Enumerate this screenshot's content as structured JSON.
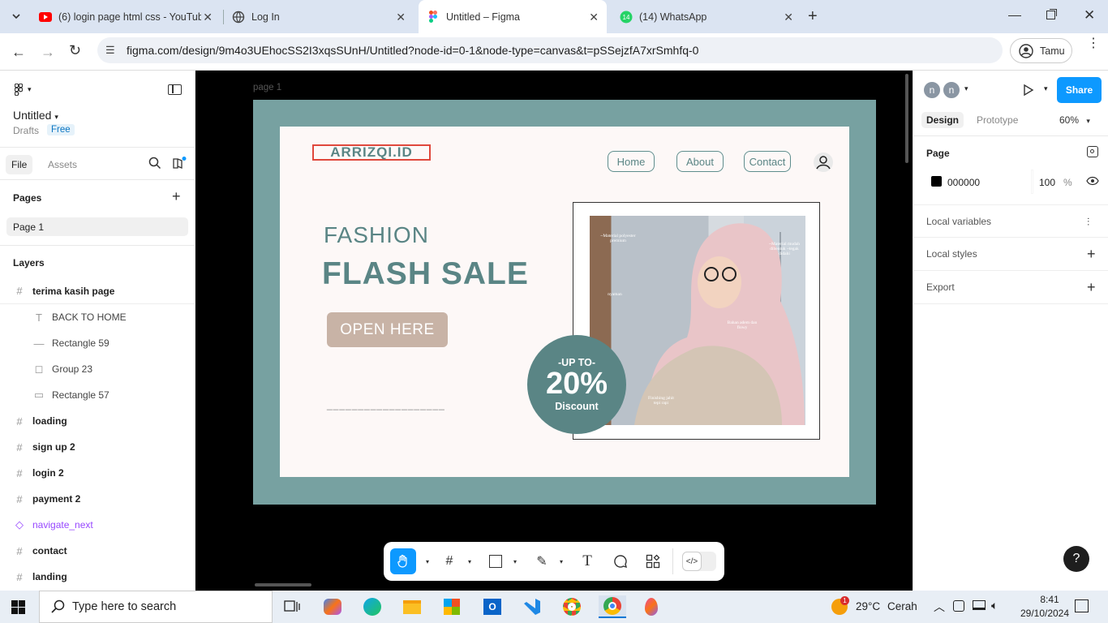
{
  "browser": {
    "tabs": [
      {
        "label": "(6) login page html css - YouTube",
        "icon": "youtube-icon"
      },
      {
        "label": "Log In",
        "icon": "globe-icon"
      },
      {
        "label": "Untitled – Figma",
        "icon": "figma-icon"
      },
      {
        "label": "(14) WhatsApp",
        "icon": "whatsapp-icon",
        "badge": "14"
      }
    ],
    "url": "figma.com/design/9m4o3UEhocSS2I3xqsSUnH/Untitled?node-id=0-1&node-type=canvas&t=pSSejzfA7xrSmhfq-0",
    "profile": "Tamu"
  },
  "figma": {
    "file_name": "Untitled",
    "drafts": "Drafts",
    "plan": "Free",
    "tabs": {
      "file": "File",
      "assets": "Assets"
    },
    "pages_heading": "Pages",
    "pages": [
      "Page 1"
    ],
    "layers_heading": "Layers",
    "layers": [
      {
        "name": "terima kasih page",
        "icon": "frame-icon",
        "level": 0
      },
      {
        "name": "BACK TO HOME",
        "icon": "text-icon",
        "level": 1
      },
      {
        "name": "Rectangle 59",
        "icon": "line-icon",
        "level": 1
      },
      {
        "name": "Group 23",
        "icon": "group-icon",
        "level": 1
      },
      {
        "name": "Rectangle 57",
        "icon": "rectangle-icon",
        "level": 1
      },
      {
        "name": "loading",
        "icon": "frame-icon",
        "level": 0
      },
      {
        "name": "sign up 2",
        "icon": "frame-icon",
        "level": 0
      },
      {
        "name": "login 2",
        "icon": "frame-icon",
        "level": 0
      },
      {
        "name": "payment 2",
        "icon": "frame-icon",
        "level": 0
      },
      {
        "name": "navigate_next",
        "icon": "component-icon",
        "level": 0
      },
      {
        "name": "contact",
        "icon": "frame-icon",
        "level": 0
      },
      {
        "name": "landing",
        "icon": "frame-icon",
        "level": 0
      }
    ],
    "right": {
      "avatars": [
        "n",
        "n"
      ],
      "share": "Share",
      "tab_design": "Design",
      "tab_prototype": "Prototype",
      "zoom": "60%",
      "page_label": "Page",
      "page_color": "000000",
      "page_opacity": "100",
      "percent": "%",
      "local_variables": "Local variables",
      "local_styles": "Local styles",
      "export": "Export"
    },
    "canvas": {
      "frame_label": "page 1",
      "logo": "ARRIZQI.ID",
      "nav": [
        "Home",
        "About",
        "Contact"
      ],
      "headline_small": "FASHION",
      "headline_big": "FLASH SALE",
      "cta": "OPEN HERE",
      "dashes": "___________________",
      "badge_top": "-UP TO-",
      "badge_value": "20%",
      "badge_bottom": "Discount",
      "photo_notes": [
        "~Material polyester premium",
        "~Material mudah dibentuk ~tegak didahi",
        "nyaman",
        "Bahan adem dan flowy",
        "Finishing jahit tepi rapi"
      ]
    },
    "help": "?"
  },
  "taskbar": {
    "search_placeholder": "Type here to search",
    "weather_temp": "29°C",
    "weather_text": "Cerah",
    "weather_badge": "1",
    "time": "8:41",
    "date": "29/10/2024"
  },
  "colors": {
    "accent": "#0d99ff",
    "teal": "#5a8585",
    "frame": "#77a1a1",
    "cta": "#c8b3a6"
  }
}
